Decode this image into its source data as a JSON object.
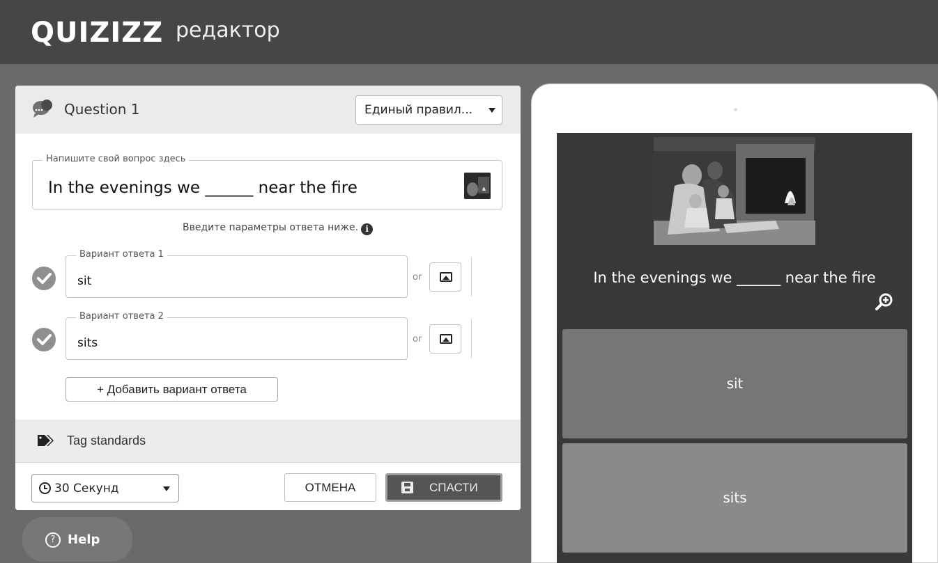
{
  "app": {
    "logo": "QUIZIZZ",
    "subtitle": "редактор"
  },
  "editor": {
    "question_title": "Question 1",
    "question_type": "Единый правил...",
    "question_field_label": "Напишите свой вопрос здесь",
    "question_text": "In the evenings we ______ near the fire",
    "answer_hint": "Введите параметры ответа ниже.",
    "info_glyph": "i",
    "or_label": "or",
    "answers": [
      {
        "label": "Вариант ответа 1",
        "value": "sit",
        "correct": true
      },
      {
        "label": "Вариант ответа 2",
        "value": "sits",
        "correct": true
      }
    ],
    "add_answer_label": "+ Добавить вариант ответа",
    "tag_label": "Tag standards",
    "time_value": "30 Секунд",
    "cancel_label": "ОТМЕНА",
    "save_label": "СПАСТИ"
  },
  "help": {
    "label": "Help",
    "glyph": "?"
  },
  "preview": {
    "question_text": "In the evenings we ______ near the fire",
    "options": [
      "sit",
      "sits"
    ]
  },
  "icons": {
    "question": "speech-bubble-icon",
    "check": "check-circle-icon",
    "image": "image-icon",
    "tag": "tag-icon",
    "clock": "clock-icon",
    "save": "floppy-disk-icon",
    "help": "question-circle-icon",
    "zoom": "zoom-in-icon",
    "dropdown": "caret-down-icon"
  }
}
